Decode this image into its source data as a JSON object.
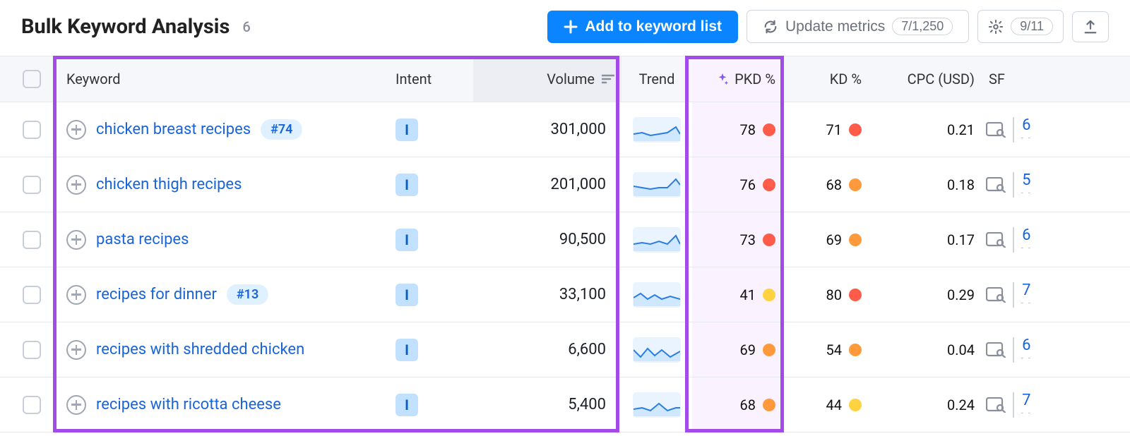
{
  "header": {
    "title": "Bulk Keyword Analysis",
    "count": "6",
    "add_button": "Add to keyword list",
    "update_button": "Update metrics",
    "update_pill": "7/1,250",
    "settings_pill": "9/11"
  },
  "columns": {
    "keyword": "Keyword",
    "intent": "Intent",
    "volume": "Volume",
    "trend": "Trend",
    "pkd": "PKD %",
    "kd": "KD %",
    "cpc": "CPC (USD)",
    "sf": "SF"
  },
  "rows": [
    {
      "keyword": "chicken breast recipes",
      "rank": "#74",
      "intent": "I",
      "volume": "301,000",
      "pkd": "78",
      "pkd_color": "red",
      "kd": "71",
      "kd_color": "red",
      "cpc": "0.21",
      "sf": "6",
      "trend": "0,22 12,20 24,24 36,22 48,20 60,12 66,22"
    },
    {
      "keyword": "chicken thigh recipes",
      "rank": "",
      "intent": "I",
      "volume": "201,000",
      "pkd": "76",
      "pkd_color": "red",
      "kd": "68",
      "kd_color": "orange",
      "cpc": "0.18",
      "sf": "5",
      "trend": "0,18 12,20 24,22 36,20 48,20 60,8 66,16"
    },
    {
      "keyword": "pasta recipes",
      "rank": "",
      "intent": "I",
      "volume": "90,500",
      "pkd": "73",
      "pkd_color": "red",
      "kd": "69",
      "kd_color": "orange",
      "cpc": "0.17",
      "sf": "6",
      "trend": "0,22 12,20 24,22 36,18 48,22 60,10 66,22"
    },
    {
      "keyword": "recipes for dinner",
      "rank": "#13",
      "intent": "I",
      "volume": "33,100",
      "pkd": "41",
      "pkd_color": "yellow",
      "kd": "80",
      "kd_color": "red",
      "cpc": "0.29",
      "sf": "7",
      "trend": "0,20 10,14 20,22 30,16 40,22 52,18 66,22"
    },
    {
      "keyword": "recipes with shredded chicken",
      "rank": "",
      "intent": "I",
      "volume": "6,600",
      "pkd": "69",
      "pkd_color": "orange",
      "kd": "54",
      "kd_color": "orange",
      "cpc": "0.04",
      "sf": "6",
      "trend": "0,16 10,26 20,14 30,24 40,16 52,26 66,18"
    },
    {
      "keyword": "recipes with ricotta cheese",
      "rank": "",
      "intent": "I",
      "volume": "5,400",
      "pkd": "68",
      "pkd_color": "orange",
      "kd": "44",
      "kd_color": "yellow",
      "cpc": "0.24",
      "sf": "7",
      "trend": "0,22 12,20 24,24 36,14 48,24 60,20 66,20"
    }
  ]
}
